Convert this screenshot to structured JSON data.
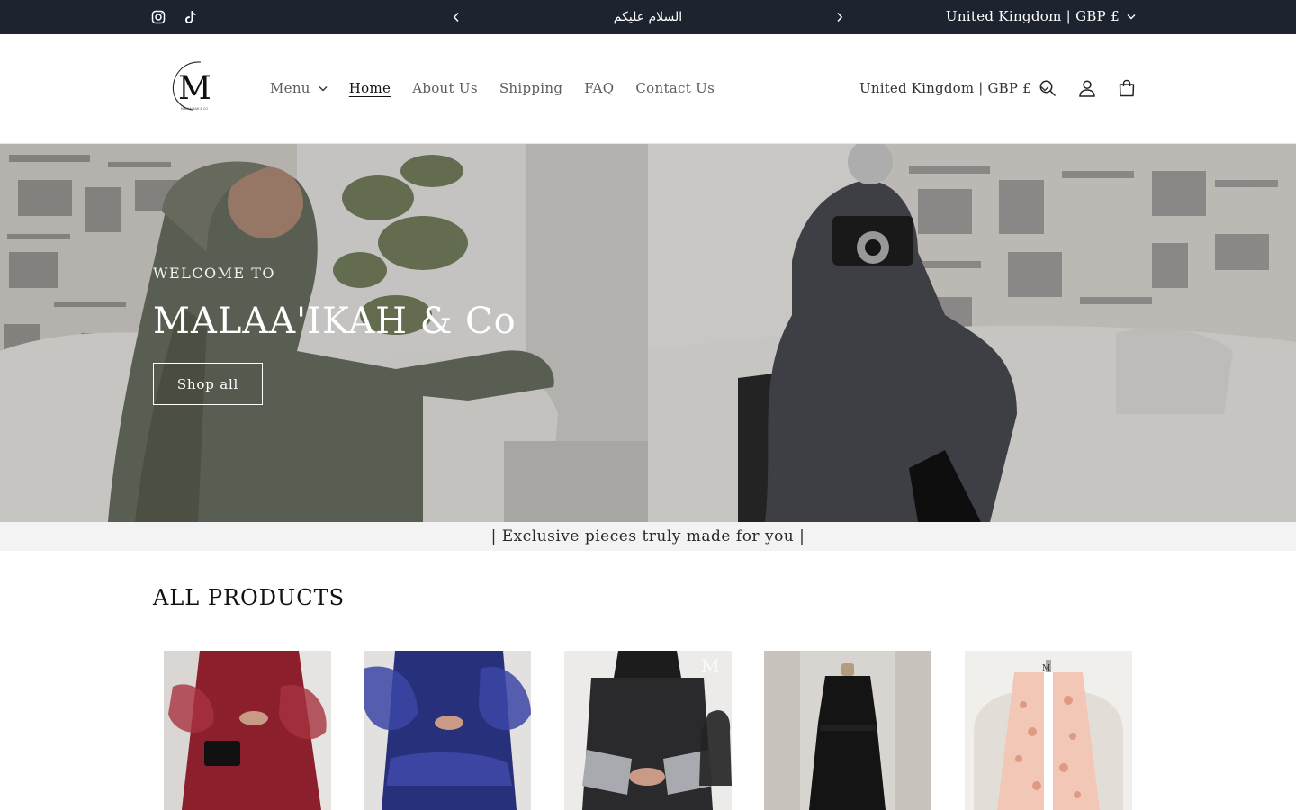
{
  "announcement": {
    "message": "السلام عليكم",
    "country_selector": "United Kingdom | GBP £",
    "social": [
      "instagram-icon",
      "tiktok-icon"
    ]
  },
  "header": {
    "logo_letter": "M",
    "logo_text": "MALAA'IKAH & CO",
    "nav": [
      {
        "label": "Menu",
        "has_dropdown": true
      },
      {
        "label": "Home",
        "active": true
      },
      {
        "label": "About Us"
      },
      {
        "label": "Shipping"
      },
      {
        "label": "FAQ"
      },
      {
        "label": "Contact Us"
      }
    ],
    "country_selector": "United Kingdom | GBP £",
    "icons": [
      "search-icon",
      "account-icon",
      "cart-icon"
    ]
  },
  "hero": {
    "subheading": "WELCOME TO",
    "heading": "MALAA'IKAH & Co",
    "button_label": "Shop all"
  },
  "tagline": "| Exclusive pieces truly made for you |",
  "products": {
    "title": "ALL PRODUCTS",
    "items": [
      {
        "image": "red-organza-abaya"
      },
      {
        "image": "blue-organza-abaya"
      },
      {
        "image": "black-embellished-abaya"
      },
      {
        "image": "black-pinafore-dress"
      },
      {
        "image": "pink-floral-kimono"
      }
    ]
  },
  "colors": {
    "announcement_bg": "#1e2330",
    "text": "#121212",
    "nav_muted": "#5c5c5c",
    "tagline_bg": "#f3f3f3"
  }
}
